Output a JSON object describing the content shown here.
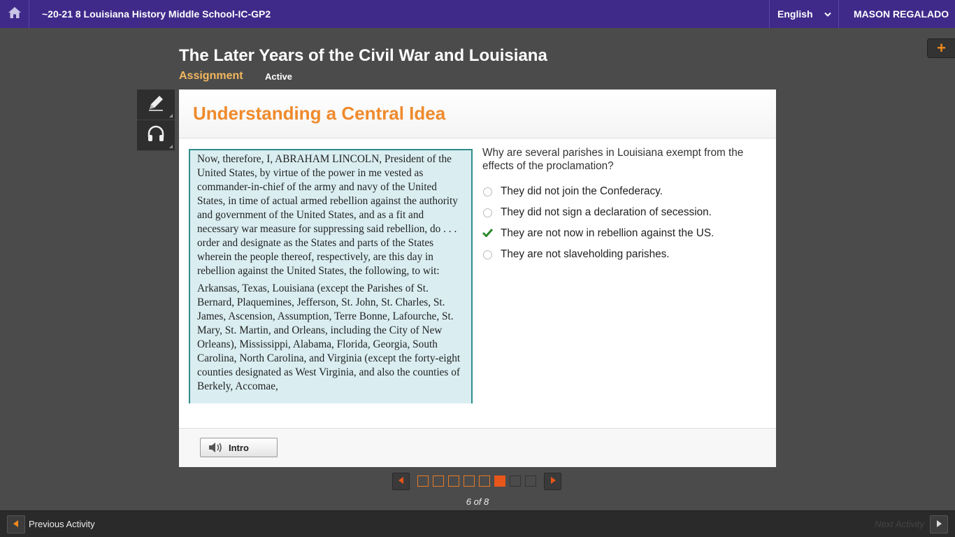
{
  "topbar": {
    "course_title": "~20-21 8 Louisiana History Middle School-IC-GP2",
    "language": "English",
    "user": "MASON REGALADO",
    "home_icon": "home-icon",
    "lang_icon": "chevron-down-icon"
  },
  "header": {
    "lesson_title": "The Later Years of the Civil War and Louisiana",
    "assignment_type": "Assignment",
    "status": "Active",
    "plus_label": "+"
  },
  "tools": [
    {
      "icon": "pencil-icon"
    },
    {
      "icon": "headphones-icon"
    }
  ],
  "card": {
    "title": "Understanding a Central Idea",
    "passage": [
      "Now, therefore, I, ABRAHAM LINCOLN, President of the United States, by virtue of the power in me vested as commander-in-chief of the army and navy of the United States, in time of actual armed rebellion against the authority and government of the United States, and as a fit and necessary war measure for suppressing said rebellion, do . . . order and designate as the States and parts of the States wherein the people thereof, respectively, are this day in rebellion against the United States, the following, to wit:",
      "Arkansas, Texas, Louisiana (except the Parishes of St. Bernard, Plaquemines, Jefferson, St. John, St. Charles, St. James, Ascension, Assumption, Terre Bonne, Lafourche, St. Mary, St. Martin, and Orleans, including the City of New Orleans), Mississippi, Alabama, Florida, Georgia, South Carolina, North Carolina, and Virginia (except the forty-eight counties designated as West Virginia, and also the counties of Berkely, Accomae,"
    ],
    "question": "Why are several parishes in Louisiana exempt from the effects of the proclamation?",
    "options": [
      {
        "label": "They did not join the Confederacy.",
        "selected": false
      },
      {
        "label": "They did not sign a declaration of secession.",
        "selected": false
      },
      {
        "label": "They are not now in rebellion against the US.",
        "selected": true
      },
      {
        "label": "They are not slaveholding parishes.",
        "selected": false
      }
    ],
    "intro_label": "Intro",
    "intro_icon": "speaker-icon"
  },
  "pager": {
    "total": 8,
    "current": 6,
    "count_label": "6 of 8",
    "completed": 5,
    "prev_icon": "triangle-left-icon",
    "next_icon": "triangle-right-icon"
  },
  "bottombar": {
    "prev_label": "Previous Activity",
    "next_label": "Next Activity"
  },
  "colors": {
    "topbar": "#3f2a8a",
    "title_orange": "#ef8a2b",
    "passage_bg": "#daeef2",
    "check_green": "#2a8a2a",
    "pager_current": "#e8561a"
  }
}
